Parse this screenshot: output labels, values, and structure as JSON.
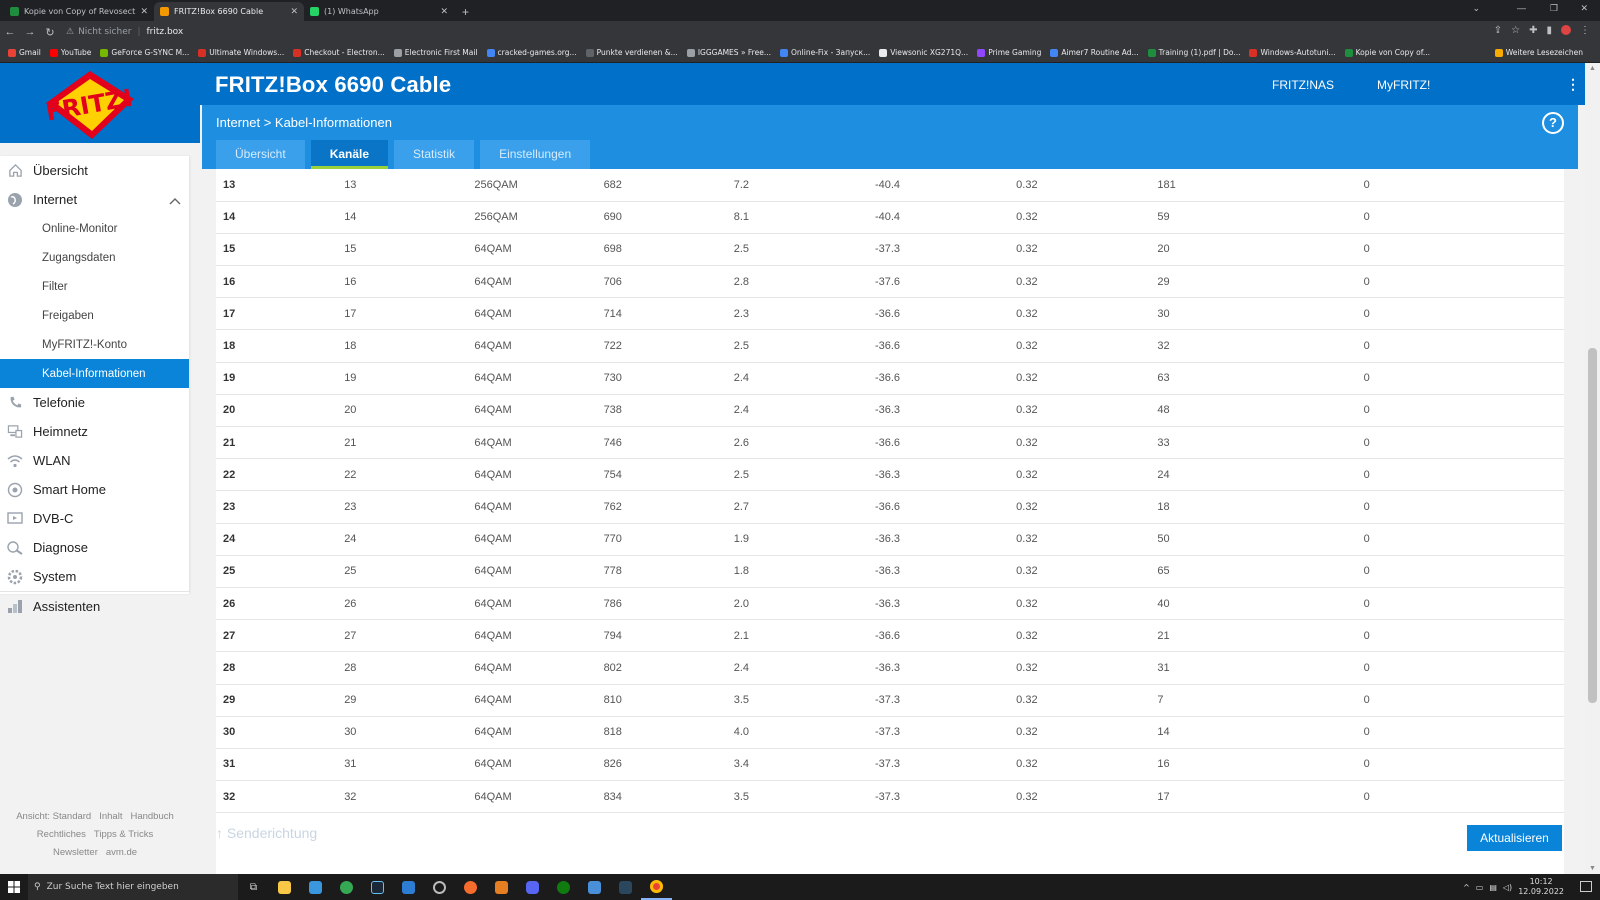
{
  "browser": {
    "tabs": [
      {
        "label": "Kopie von Copy of Revosect x Ai",
        "color": "#1e8e3e",
        "active": false
      },
      {
        "label": "FRITZ!Box 6690 Cable",
        "color": "#f29900",
        "active": true
      },
      {
        "label": "(1) WhatsApp",
        "color": "#25d366",
        "active": false
      }
    ],
    "security_label": "Nicht sicher",
    "url": "fritz.box",
    "bookmarks": [
      {
        "label": "Gmail",
        "color": "#ea4335"
      },
      {
        "label": "YouTube",
        "color": "#ff0000"
      },
      {
        "label": "GeForce G-SYNC M...",
        "color": "#76b900"
      },
      {
        "label": "Ultimate Windows...",
        "color": "#d93025"
      },
      {
        "label": "Checkout - Electron...",
        "color": "#d93025"
      },
      {
        "label": "Electronic First Mail",
        "color": "#9aa0a6"
      },
      {
        "label": "cracked-games.org...",
        "color": "#4285f4"
      },
      {
        "label": "Punkte verdienen &...",
        "color": "#5f6368"
      },
      {
        "label": "IGGGAMES » Free...",
        "color": "#9aa0a6"
      },
      {
        "label": "Online-Fix - Запуск...",
        "color": "#4285f4"
      },
      {
        "label": "Viewsonic XG271Q...",
        "color": "#e8eaed"
      },
      {
        "label": "Prime Gaming",
        "color": "#9146ff"
      },
      {
        "label": "Aimer7 Routine Ad...",
        "color": "#4285f4"
      },
      {
        "label": "Training (1).pdf | Do...",
        "color": "#1e8e3e"
      },
      {
        "label": "Windows-Autotuni...",
        "color": "#d93025"
      },
      {
        "label": "Kopie von Copy of...",
        "color": "#1e8e3e"
      }
    ],
    "other_bookmarks": "Weitere Lesezeichen"
  },
  "header": {
    "logo_text": "FRITZ!",
    "title": "FRITZ!Box 6690 Cable",
    "links": [
      "FRITZ!NAS",
      "MyFRITZ!"
    ],
    "breadcrumb": "Internet > Kabel-Informationen",
    "help": "?"
  },
  "tabs": [
    {
      "label": "Übersicht",
      "active": false
    },
    {
      "label": "Kanäle",
      "active": true
    },
    {
      "label": "Statistik",
      "active": false
    },
    {
      "label": "Einstellungen",
      "active": false
    }
  ],
  "sidebar": {
    "items": [
      {
        "label": "Übersicht",
        "icon": "home-icon",
        "level": 0
      },
      {
        "label": "Internet",
        "icon": "globe-icon",
        "level": 0,
        "expanded": true
      },
      {
        "label": "Online-Monitor",
        "level": 1
      },
      {
        "label": "Zugangsdaten",
        "level": 1
      },
      {
        "label": "Filter",
        "level": 1
      },
      {
        "label": "Freigaben",
        "level": 1
      },
      {
        "label": "MyFRITZ!-Konto",
        "level": 1
      },
      {
        "label": "Kabel-Informationen",
        "level": 1,
        "active": true
      },
      {
        "label": "Telefonie",
        "icon": "phone-icon",
        "level": 0
      },
      {
        "label": "Heimnetz",
        "icon": "network-icon",
        "level": 0
      },
      {
        "label": "WLAN",
        "icon": "wifi-icon",
        "level": 0
      },
      {
        "label": "Smart Home",
        "icon": "smart-home-icon",
        "level": 0
      },
      {
        "label": "DVB-C",
        "icon": "tv-icon",
        "level": 0
      },
      {
        "label": "Diagnose",
        "icon": "diagnose-icon",
        "level": 0
      },
      {
        "label": "System",
        "icon": "system-icon",
        "level": 0
      },
      {
        "label": "Assistenten",
        "icon": "wizard-icon",
        "level": 0
      }
    ],
    "footer": [
      [
        "Ansicht: Standard",
        "Inhalt",
        "Handbuch"
      ],
      [
        "Rechtliches",
        "Tipps & Tricks"
      ],
      [
        "Newsletter",
        "avm.de"
      ]
    ]
  },
  "channels": [
    [
      "13",
      "13",
      "256QAM",
      "682",
      "7.2",
      "-40.4",
      "0.32",
      "181",
      "0"
    ],
    [
      "14",
      "14",
      "256QAM",
      "690",
      "8.1",
      "-40.4",
      "0.32",
      "59",
      "0"
    ],
    [
      "15",
      "15",
      "64QAM",
      "698",
      "2.5",
      "-37.3",
      "0.32",
      "20",
      "0"
    ],
    [
      "16",
      "16",
      "64QAM",
      "706",
      "2.8",
      "-37.6",
      "0.32",
      "29",
      "0"
    ],
    [
      "17",
      "17",
      "64QAM",
      "714",
      "2.3",
      "-36.6",
      "0.32",
      "30",
      "0"
    ],
    [
      "18",
      "18",
      "64QAM",
      "722",
      "2.5",
      "-36.6",
      "0.32",
      "32",
      "0"
    ],
    [
      "19",
      "19",
      "64QAM",
      "730",
      "2.4",
      "-36.6",
      "0.32",
      "63",
      "0"
    ],
    [
      "20",
      "20",
      "64QAM",
      "738",
      "2.4",
      "-36.3",
      "0.32",
      "48",
      "0"
    ],
    [
      "21",
      "21",
      "64QAM",
      "746",
      "2.6",
      "-36.6",
      "0.32",
      "33",
      "0"
    ],
    [
      "22",
      "22",
      "64QAM",
      "754",
      "2.5",
      "-36.3",
      "0.32",
      "24",
      "0"
    ],
    [
      "23",
      "23",
      "64QAM",
      "762",
      "2.7",
      "-36.6",
      "0.32",
      "18",
      "0"
    ],
    [
      "24",
      "24",
      "64QAM",
      "770",
      "1.9",
      "-36.3",
      "0.32",
      "50",
      "0"
    ],
    [
      "25",
      "25",
      "64QAM",
      "778",
      "1.8",
      "-36.3",
      "0.32",
      "65",
      "0"
    ],
    [
      "26",
      "26",
      "64QAM",
      "786",
      "2.0",
      "-36.3",
      "0.32",
      "40",
      "0"
    ],
    [
      "27",
      "27",
      "64QAM",
      "794",
      "2.1",
      "-36.6",
      "0.32",
      "21",
      "0"
    ],
    [
      "28",
      "28",
      "64QAM",
      "802",
      "2.4",
      "-36.3",
      "0.32",
      "31",
      "0"
    ],
    [
      "29",
      "29",
      "64QAM",
      "810",
      "3.5",
      "-37.3",
      "0.32",
      "7",
      "0"
    ],
    [
      "30",
      "30",
      "64QAM",
      "818",
      "4.0",
      "-37.3",
      "0.32",
      "14",
      "0"
    ],
    [
      "31",
      "31",
      "64QAM",
      "826",
      "3.4",
      "-37.3",
      "0.32",
      "16",
      "0"
    ],
    [
      "32",
      "32",
      "64QAM",
      "834",
      "3.5",
      "-37.3",
      "0.32",
      "17",
      "0"
    ]
  ],
  "section_label": "↑ Senderichtung",
  "refresh_label": "Aktualisieren",
  "taskbar": {
    "search_placeholder": "Zur Suche Text hier eingeben",
    "time": "10:12",
    "date": "12.09.2022"
  }
}
